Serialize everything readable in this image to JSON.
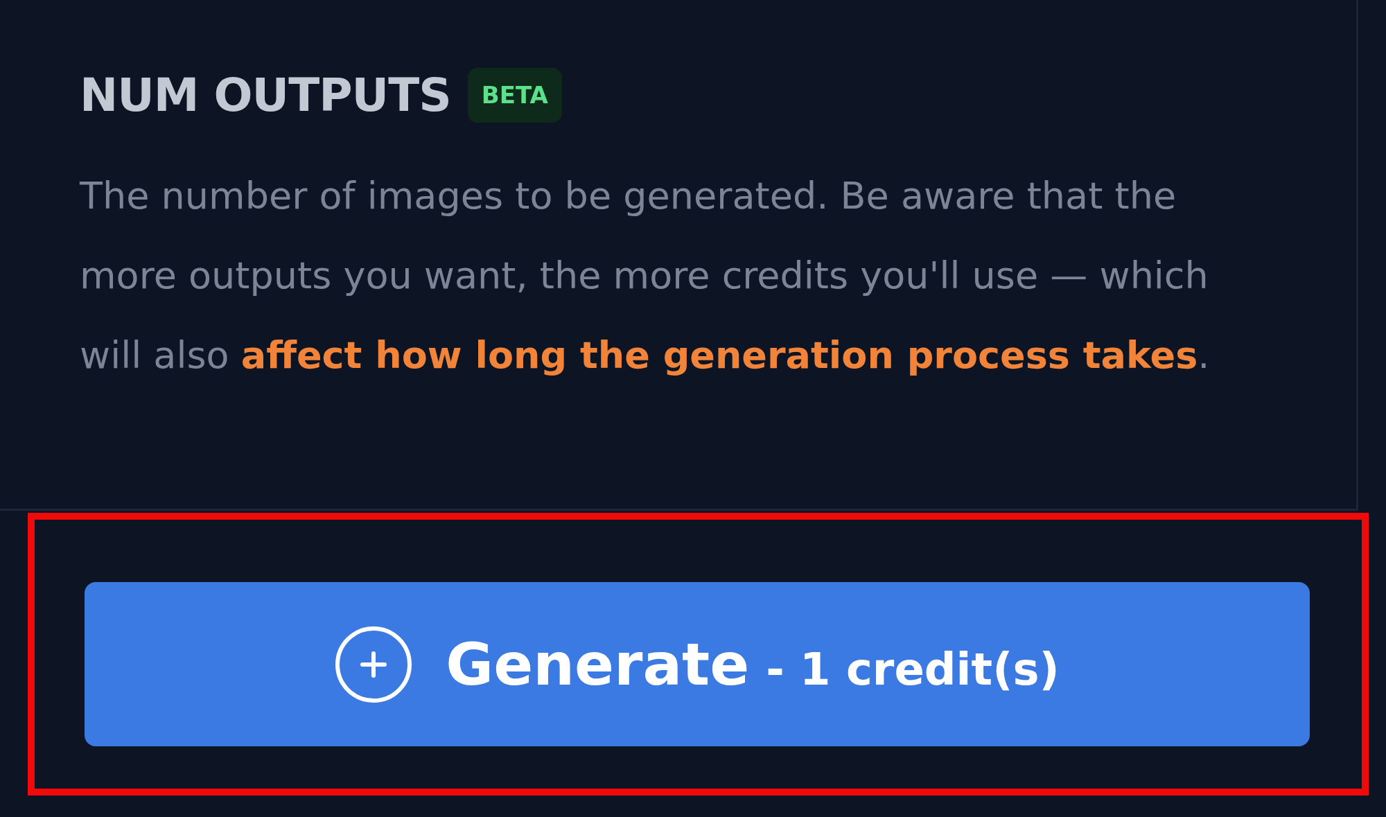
{
  "field": {
    "title": "NUM OUTPUTS",
    "badge": "BETA",
    "description": "The number of images to be generated. Be aware that the more outputs you want, the more credits you'll use — which will also **affect how long the generation process takes**."
  },
  "generate": {
    "highlighted": true,
    "label": "Generate",
    "cost": "- 1 credit(s)"
  }
}
